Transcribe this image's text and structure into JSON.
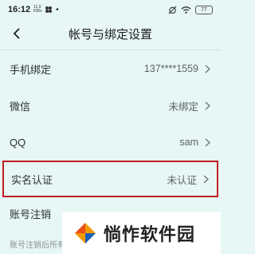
{
  "status_bar": {
    "time": "16:12",
    "network_speed": "11.0 KB/s",
    "battery": "77"
  },
  "header": {
    "title": "帐号与绑定设置"
  },
  "rows": [
    {
      "label": "手机绑定",
      "value": "137****1559"
    },
    {
      "label": "微信",
      "value": "未绑定"
    },
    {
      "label": "QQ",
      "value": "sam"
    },
    {
      "label": "实名认证",
      "value": "未认证"
    },
    {
      "label": "账号注销",
      "value": ""
    }
  ],
  "footnote": "账号注销后所有",
  "watermark": {
    "text": "惝怍软件园"
  },
  "colors": {
    "background": "#e6f7f5",
    "highlight_border": "#c21e25"
  },
  "icons": {
    "back": "chevron-left-icon",
    "row_arrow": "chevron-right-icon"
  }
}
